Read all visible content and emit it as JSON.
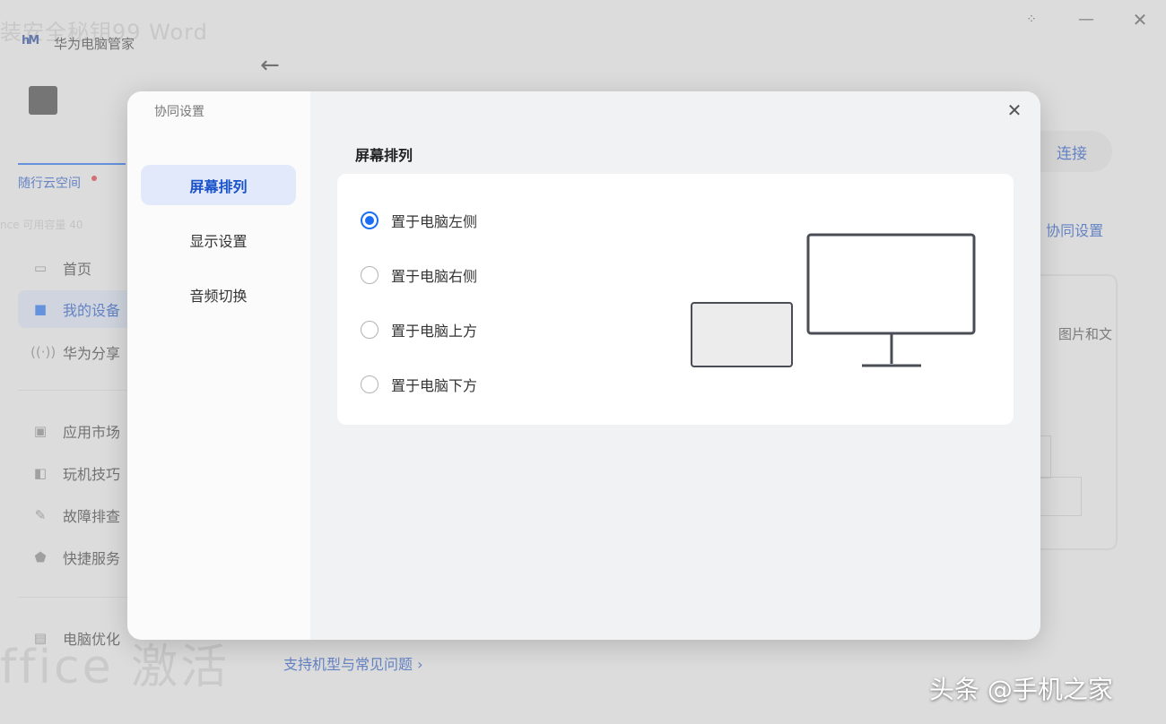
{
  "background_app": {
    "watermark_top": "装安全秘钥99 Word",
    "app_logo": "hM",
    "app_name": "华为电脑管家",
    "window_controls": {
      "dots": "⁘",
      "minimize": "—",
      "close": "✕"
    },
    "back": "←",
    "account_tab": "随行云空间",
    "cloud_info": "nce 可用容量 40",
    "nav_items": [
      {
        "label": "首页",
        "icon": "laptop-icon"
      },
      {
        "label": "我的设备",
        "icon": "devices-icon"
      },
      {
        "label": "华为分享",
        "icon": "wireless-share-icon"
      },
      {
        "label": "应用市场",
        "icon": "store-icon"
      },
      {
        "label": "玩机技巧",
        "icon": "tips-icon"
      },
      {
        "label": "故障排查",
        "icon": "wrench-icon"
      },
      {
        "label": "快捷服务",
        "icon": "shield-icon"
      },
      {
        "label": "电脑优化",
        "icon": "optimize-icon"
      }
    ],
    "watermark_bottom": "ffice 激活",
    "connect_button": "连接",
    "collab_link": "· 协同设置",
    "side_card_text": "图片和文",
    "support_link": "支持机型与常见问题 ›"
  },
  "dialog": {
    "title": "协同设置",
    "close": "✕",
    "nav": [
      {
        "label": "屏幕排列",
        "active": true
      },
      {
        "label": "显示设置",
        "active": false
      },
      {
        "label": "音频切换",
        "active": false
      }
    ],
    "section_title": "屏幕排列",
    "options": [
      {
        "label": "置于电脑左侧",
        "checked": true
      },
      {
        "label": "置于电脑右侧",
        "checked": false
      },
      {
        "label": "置于电脑上方",
        "checked": false
      },
      {
        "label": "置于电脑下方",
        "checked": false
      }
    ],
    "accent_color": "#1a6df5"
  },
  "credit": "头条 @手机之家"
}
